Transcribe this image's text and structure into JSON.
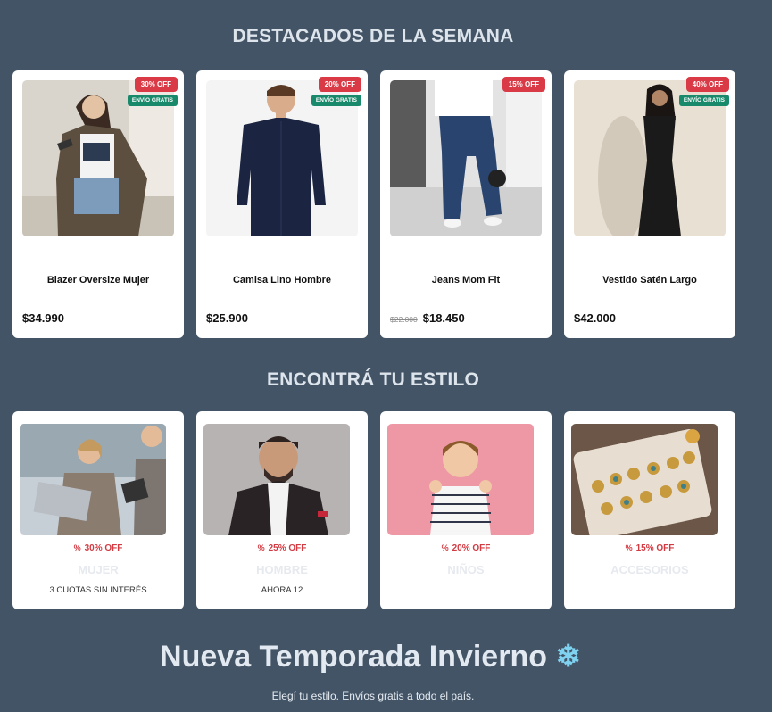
{
  "featured": {
    "title": "DESTACADOS DE LA SEMANA",
    "products": [
      {
        "name": "Blazer Oversize Mujer",
        "price": "$34.990",
        "old_price": "",
        "discount": "30% OFF",
        "shipping": "ENVÍO GRATIS"
      },
      {
        "name": "Camisa Lino Hombre",
        "price": "$25.900",
        "old_price": "",
        "discount": "20% OFF",
        "shipping": "ENVÍO GRATIS"
      },
      {
        "name": "Jeans Mom Fit",
        "price": "$18.450",
        "old_price": "$22.000",
        "discount": "15% OFF",
        "shipping": ""
      },
      {
        "name": "Vestido Satén Largo",
        "price": "$42.000",
        "old_price": "",
        "discount": "40% OFF",
        "shipping": "ENVÍO GRATIS"
      }
    ]
  },
  "styles": {
    "title": "ENCONTRÁ TU ESTILO",
    "categories": [
      {
        "name": "MUJER",
        "discount": "30% OFF",
        "subtitle": "3 CUOTAS SIN INTERÉS"
      },
      {
        "name": "HOMBRE",
        "discount": "25% OFF",
        "subtitle": "AHORA 12"
      },
      {
        "name": "NIÑOS",
        "discount": "20% OFF",
        "subtitle": ""
      },
      {
        "name": "ACCESORIOS",
        "discount": "15% OFF",
        "subtitle": ""
      }
    ]
  },
  "hero": {
    "title": "Nueva Temporada Invierno",
    "subtitle": "Elegí tu estilo. Envíos gratis a todo el país."
  },
  "icons": {
    "percent": "percent-icon",
    "snowflake": "snowflake-icon"
  },
  "colors": {
    "background": "#435466",
    "discount_badge": "#d93a45",
    "shipping_badge": "#18896a",
    "accent_discount_text": "#d33a42"
  }
}
